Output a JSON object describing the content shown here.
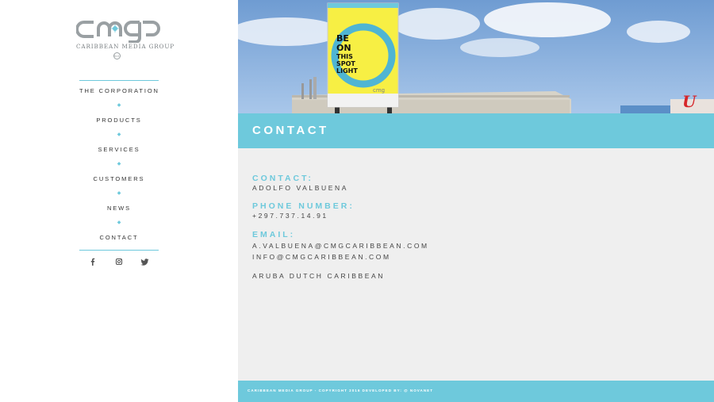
{
  "logo": {
    "name": "CARIBBEAN MEDIA GROUP",
    "badge": "N.V."
  },
  "nav": {
    "items": [
      {
        "label": "THE CORPORATION"
      },
      {
        "label": "PRODUCTS"
      },
      {
        "label": "SERVICES"
      },
      {
        "label": "CUSTOMERS"
      },
      {
        "label": "NEWS"
      },
      {
        "label": "CONTACT"
      }
    ]
  },
  "social": [
    {
      "icon": "facebook-icon",
      "glyph": "f"
    },
    {
      "icon": "instagram-icon",
      "glyph": "◻"
    },
    {
      "icon": "twitter-icon",
      "glyph": "🐦"
    }
  ],
  "hero": {
    "billboard_lines": [
      "BE",
      "ON",
      "THIS",
      "SPOT",
      "LIGHT"
    ],
    "billboard_brand": "cmg"
  },
  "page": {
    "title": "CONTACT"
  },
  "contact": {
    "contact_label": "CONTACT:",
    "contact_name": "ADOLFO VALBUENA",
    "phone_label": "PHONE NUMBER:",
    "phone_value": "+297.737.14.91",
    "email_label": "EMAIL:",
    "email_1": "A.VALBUENA@CMGCARIBBEAN.COM",
    "email_2": "INFO@CMGCARIBBEAN.COM",
    "location": "ARUBA DUTCH CARIBBEAN"
  },
  "footer": {
    "text": "CARIBBEAN MEDIA GROUP - COPYRIGHT 2016 DEVELOPED BY: @ NOVANET"
  },
  "colors": {
    "accent": "#6ec9dc",
    "text": "#444444",
    "main_bg": "#efefef"
  }
}
